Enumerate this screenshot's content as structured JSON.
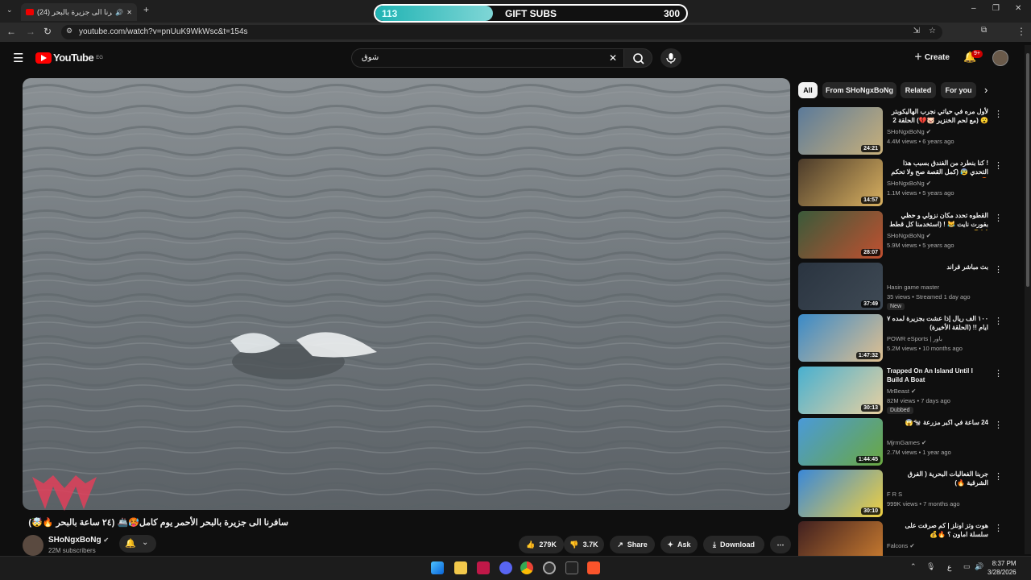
{
  "browser": {
    "tab_title": "سافرنا الى جزيرة بالبحر (24)",
    "tab_close": "✕",
    "new_tab": "+",
    "url": "youtube.com/watch?v=pnUuK9WkWsc&t=154s"
  },
  "overlay": {
    "gift_label": "GIFT SUBS",
    "gift_current": "113",
    "gift_goal": "300",
    "gift_progress": 0.377,
    "watermark_text": "ϢϢ"
  },
  "header": {
    "logo_text": "YouTube",
    "region": "EG",
    "search_value": "شوق",
    "create_label": "Create",
    "notif_badge": "9+"
  },
  "video": {
    "title": "سافرنا الى جزيرة بالبحر الأحمر يوم كامل🥵🚢 (٢٤ ساعة بالبحر 🔥🤯)",
    "channel": "SHoNgxBoNg",
    "subscribers": "22M subscribers",
    "likes": "279K",
    "dislikes": "3.7K",
    "share": "Share",
    "ask": "Ask",
    "download": "Download"
  },
  "chips": [
    "All",
    "From SHoNgxBoNg",
    "Related",
    "For you"
  ],
  "related": [
    {
      "title": "لأول مره في حياتي نجرب الهاليكوبتر 😮 (مع لحم الخنزير 🐷💔) الحلقة 2",
      "channel": "SHoNgxBoNg",
      "meta": "4.4M views • 6 years ago",
      "duration": "24:21",
      "badge": "",
      "verified": true,
      "rtl": true,
      "colors": [
        "#5b7a9a",
        "#c8b07a"
      ]
    },
    {
      "title": "! كنا بنطرد من الفندق بسبب هذا التحدي 😰 (كمل القصة صح ولا تحكم 😡)",
      "channel": "SHoNgxBoNg",
      "meta": "1.1M views • 5 years ago",
      "duration": "14:57",
      "badge": "",
      "verified": true,
      "rtl": true,
      "colors": [
        "#4a3a2a",
        "#d8b060"
      ]
    },
    {
      "title": "القطوه تحدد مكان نزولي و حظي بفورت نايت 😹 ! (استخدمنا كل قطط 🐱😂)",
      "channel": "SHoNgxBoNg",
      "meta": "5.9M views • 5 years ago",
      "duration": "28:07",
      "badge": "",
      "verified": true,
      "rtl": true,
      "colors": [
        "#3a5a3a",
        "#c05030"
      ]
    },
    {
      "title": "بث مباشر قراند",
      "channel": "Hasin game master",
      "meta": "35 views • Streamed 1 day ago",
      "duration": "37:49",
      "badge": "New",
      "verified": false,
      "rtl": true,
      "colors": [
        "#2a3440",
        "#3f4a55"
      ]
    },
    {
      "title": "١٠٠ الف ريال إذا عشت بجزيرة لمده ٧ ايام !! (الحلقة الأخيرة)",
      "channel": "POWR eSports | باور",
      "meta": "5.2M views • 10 months ago",
      "duration": "1:47:32",
      "badge": "",
      "verified": false,
      "rtl": true,
      "colors": [
        "#3a8ac8",
        "#e0c090"
      ]
    },
    {
      "title": "Trapped On An Island Until I Build A Boat",
      "channel": "MrBeast",
      "meta": "82M views • 7 days ago",
      "duration": "30:13",
      "badge": "Dubbed",
      "verified": true,
      "rtl": false,
      "colors": [
        "#48b0d0",
        "#e8d0a0"
      ]
    },
    {
      "title": "24 ساعة في اكبر مزرعة 🐄😱",
      "channel": "MjrmGames",
      "meta": "2.7M views • 1 year ago",
      "duration": "1:44:45",
      "badge": "",
      "verified": true,
      "rtl": true,
      "colors": [
        "#4a9ad8",
        "#6aa840"
      ]
    },
    {
      "title": "جربنا الفعاليات البحرية ( الفرق الشرقية 🔥)",
      "channel": "F R S",
      "meta": "999K views • 7 months ago",
      "duration": "30:10",
      "badge": "",
      "verified": false,
      "rtl": true,
      "colors": [
        "#3a88d8",
        "#f0d040"
      ]
    },
    {
      "title": "هوت وتز اونلز | كم صرفت على سلسلة اماون ؟ 🔥💰",
      "channel": "Falcons",
      "meta": "",
      "duration": "",
      "badge": "",
      "verified": true,
      "rtl": true,
      "colors": [
        "#402020",
        "#d08030"
      ]
    }
  ],
  "taskbar": {
    "time": "8:37 PM",
    "date": "3/28/2026",
    "lang": "ع"
  }
}
